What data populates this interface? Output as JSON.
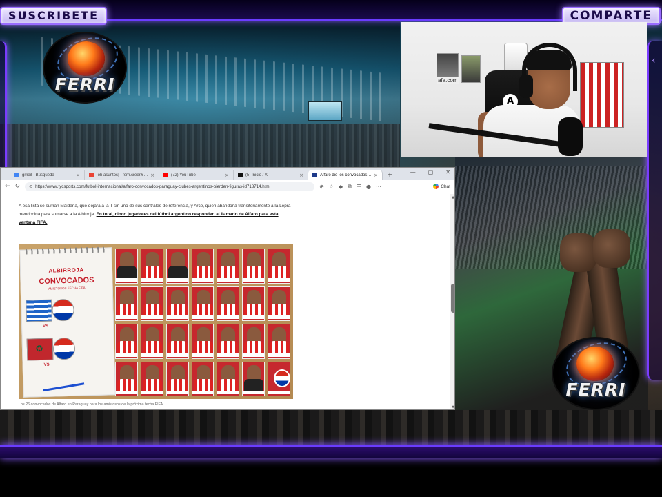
{
  "overlay": {
    "subscribe_label": "SUSCRIBETE",
    "share_label": "COMPARTE",
    "logo_text": "FERRI",
    "accent_color": "#7a3cff",
    "webcam_poster_label": "afa.com"
  },
  "browser": {
    "tabs": [
      {
        "title": "gmail - Búsqueda",
        "icon": "google-icon",
        "active": false
      },
      {
        "title": "[oh asuntos] - ferri.creer.63@gm",
        "icon": "gmail-icon",
        "active": false
      },
      {
        "title": "(72) YouTube",
        "icon": "youtube-icon",
        "active": false
      },
      {
        "title": "(5) Inicio / X",
        "icon": "x-icon",
        "active": false
      },
      {
        "title": "Alfaro dio los convocados de Par",
        "icon": "tyc-icon",
        "active": true
      }
    ],
    "url": "https://www.tycsports.com/futbol-internacional/alfaro-convocados-paraguay-clubes-argentinos-pierden-figuras-id718714.html",
    "chat_label": "Chat"
  },
  "article": {
    "paragraph_plain": "A esa lista se suman Maidana, que dejará a la T sin uno de sus centrales de referencia, y Arce, quien abandona transitoriamente a la Lepra mendocina para sumarse a la Albirroja. ",
    "paragraph_bold": "En total, cinco jugadores del fútbol argentino responden al llamado de Alfaro para esta ventana FIFA.",
    "image": {
      "album_title_top": "ALBIRROJA",
      "album_title_main": "CONVOCADOS",
      "album_subtitle": "AMISTOSOS FECHA FIFA",
      "vs_label": "VS",
      "sticker_rows": 4,
      "sticker_cols": 7
    },
    "caption": "Los 26 convocados de Alfaro en Paraguay para los amistosos de la próxima fecha FIFA"
  }
}
